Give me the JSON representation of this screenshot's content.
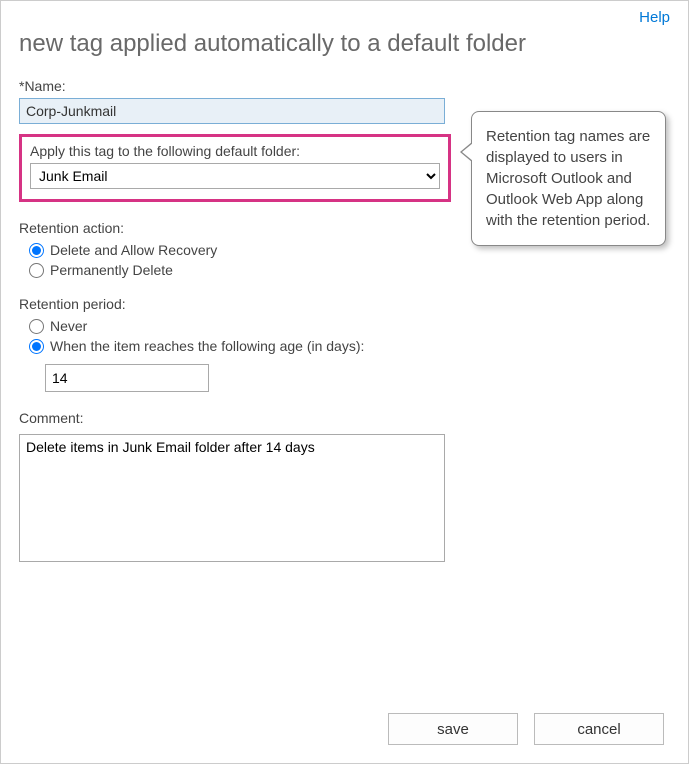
{
  "header": {
    "help_label": "Help"
  },
  "title": "new tag applied automatically to a default folder",
  "form": {
    "name_label": "*Name:",
    "name_value": "Corp-Junkmail",
    "folder_label": "Apply this tag to the following default folder:",
    "folder_selected": "Junk Email",
    "retention_action_label": "Retention action:",
    "retention_actions": [
      {
        "label": "Delete and Allow Recovery",
        "selected": true
      },
      {
        "label": "Permanently Delete",
        "selected": false
      }
    ],
    "retention_period_label": "Retention period:",
    "retention_periods": [
      {
        "label": "Never",
        "selected": false
      },
      {
        "label": "When the item reaches the following age (in days):",
        "selected": true
      }
    ],
    "days_value": "14",
    "comment_label": "Comment:",
    "comment_value": "Delete items in Junk Email folder after 14 days"
  },
  "callout": {
    "text": "Retention tag names are displayed to users in Microsoft Outlook and Outlook Web App along with the retention period."
  },
  "buttons": {
    "save_label": "save",
    "cancel_label": "cancel"
  }
}
